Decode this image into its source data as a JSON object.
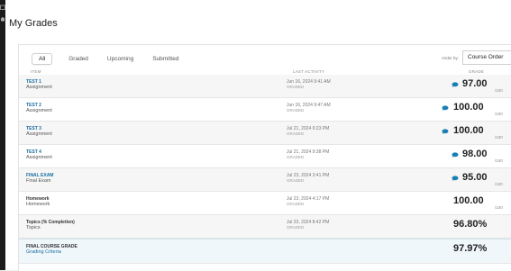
{
  "page": {
    "title": "My Grades"
  },
  "tabs": [
    "All",
    "Graded",
    "Upcoming",
    "Submitted"
  ],
  "order_by": {
    "label": "Order by:",
    "value": "Course Order"
  },
  "columns": {
    "item": "ITEM",
    "activity": "LAST ACTIVITY",
    "grade": "GRADE"
  },
  "rows": [
    {
      "name": "TEST 1",
      "type": "Assignment",
      "date": "Jun 16, 2024 9:41 AM",
      "status": "GRADED",
      "score": "97.00",
      "out_of": "/100"
    },
    {
      "name": "TEST 2",
      "type": "Assignment",
      "date": "Jun 16, 2024 9:47 AM",
      "status": "GRADED",
      "score": "100.00",
      "out_of": "/100"
    },
    {
      "name": "TEST 3",
      "type": "Assignment",
      "date": "Jul 21, 2024 9:23 PM",
      "status": "GRADED",
      "score": "100.00",
      "out_of": "/100"
    },
    {
      "name": "TEST 4",
      "type": "Assignment",
      "date": "Jul 21, 2024 9:38 PM",
      "status": "GRADED",
      "score": "98.00",
      "out_of": "/100"
    },
    {
      "name": "FINAL EXAM",
      "type": "Final Exam",
      "date": "Jul 23, 2024 3:41 PM",
      "status": "GRADED",
      "score": "95.00",
      "out_of": "/100"
    },
    {
      "name": "Homework",
      "type": "Homework",
      "date": "Jul 23, 2024 4:17 PM",
      "status": "GRADED",
      "score": "100.00",
      "out_of": "/100"
    },
    {
      "name": "Topics (% Completion)",
      "type": "Topics",
      "date": "Jul 23, 2024 8:42 PM",
      "status": "GRADED",
      "score": "96.80%"
    },
    {
      "name": "FINAL COURSE GRADE",
      "type": "Grading Criteria",
      "score": "97.97%"
    }
  ],
  "colors": {
    "link": "#1a6ea3",
    "bubble": "#1a7fb5",
    "sidebar": "#1b1b1b"
  },
  "icons": {
    "sidebar": [
      "calendar-icon",
      "home-icon"
    ],
    "feedback": "comment-bubble-icon"
  }
}
